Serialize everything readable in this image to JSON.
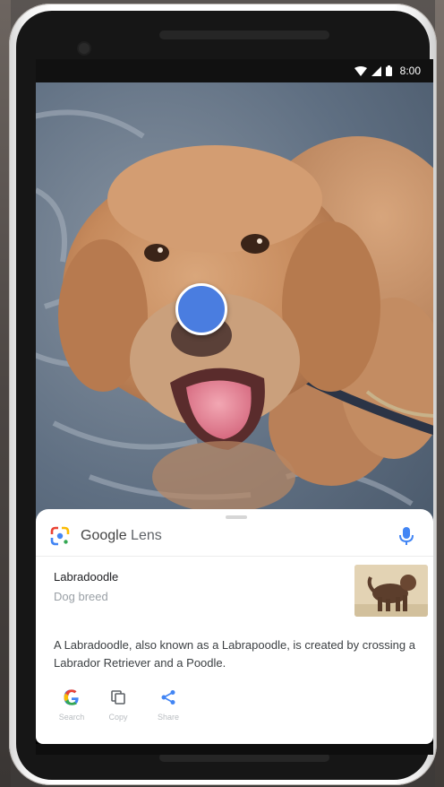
{
  "status_bar": {
    "time": "8:00",
    "icons": [
      "wifi-icon",
      "signal-icon",
      "battery-icon"
    ]
  },
  "lens": {
    "brand": "Google",
    "product": "Lens",
    "mic_icon": "mic-icon",
    "logo_icon": "google-lens-icon"
  },
  "result": {
    "name": "Labradoodle",
    "subtitle": "Dog breed",
    "description": "A Labradoodle, also known as a Labrapoodle, is created by crossing a Labrador Retriever and a Poodle."
  },
  "actions": [
    {
      "label": "Search",
      "icon": "google-g-icon"
    },
    {
      "label": "Copy",
      "icon": "copy-icon"
    },
    {
      "label": "Share",
      "icon": "share-icon"
    }
  ],
  "colors": {
    "lens_dot": "#4a7de0",
    "accent_blue": "#4285f4",
    "google_red": "#ea4335",
    "google_yellow": "#fbbc05",
    "google_green": "#34a853"
  }
}
